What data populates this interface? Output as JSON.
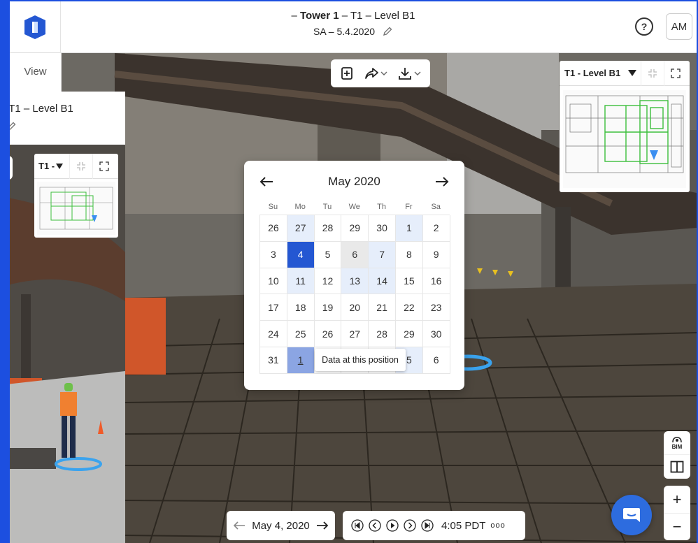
{
  "header": {
    "title_prefix": "– ",
    "title_bold": "Tower 1",
    "title_suffix": " – T1 – Level B1",
    "subtitle": "SA – 5.4.2020",
    "help_label": "?",
    "avatar_initials": "AM"
  },
  "sidebar": {
    "view_label": "View"
  },
  "left_panel": {
    "title": "– T1 – Level B1",
    "minimap_label": "T1 -"
  },
  "minimap": {
    "label": "T1 - Level B1"
  },
  "calendar": {
    "month_title": "May 2020",
    "weekdays": [
      "Su",
      "Mo",
      "Tu",
      "We",
      "Th",
      "Fr",
      "Sa"
    ],
    "rows": [
      [
        "26",
        "27",
        "28",
        "29",
        "30",
        "1",
        "2"
      ],
      [
        "3",
        "4",
        "5",
        "6",
        "7",
        "8",
        "9"
      ],
      [
        "10",
        "11",
        "12",
        "13",
        "14",
        "15",
        "16"
      ],
      [
        "17",
        "18",
        "19",
        "20",
        "21",
        "22",
        "23"
      ],
      [
        "24",
        "25",
        "26",
        "27",
        "28",
        "29",
        "30"
      ],
      [
        "31",
        "1",
        "",
        "",
        "",
        "5",
        "6"
      ]
    ],
    "tooltip": "Data at this position"
  },
  "date_nav": {
    "label": "May 4, 2020"
  },
  "playback": {
    "time": "4:05 PDT",
    "more": "ooo"
  },
  "side_tools": {
    "bim_label": "BIM"
  },
  "zoom": {
    "in": "+",
    "out": "−"
  },
  "colors": {
    "accent": "#2457d2",
    "frame": "#1c4fe0",
    "available": "#e6eefb",
    "chat": "#2d6cdf"
  }
}
